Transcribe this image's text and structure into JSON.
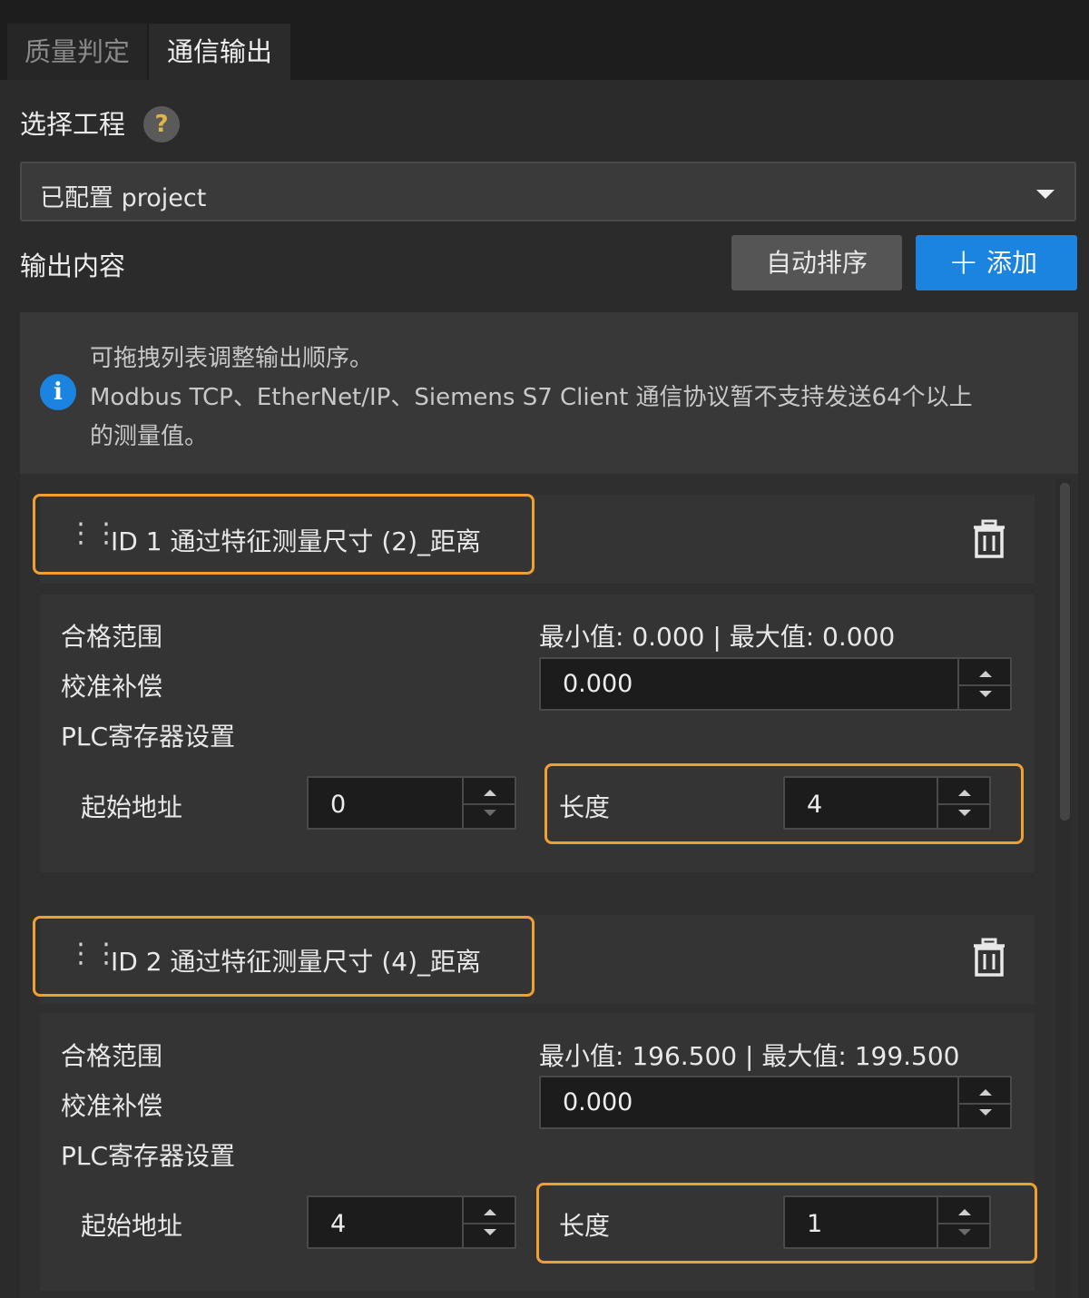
{
  "tabs": [
    {
      "label": "质量判定",
      "active": false
    },
    {
      "label": "通信输出",
      "active": true
    }
  ],
  "project_section": {
    "label": "选择工程",
    "help_icon": "?",
    "dropdown_value": "已配置 project"
  },
  "output_section": {
    "label": "输出内容",
    "sort_button": "自动排序",
    "add_button": "添加"
  },
  "info": {
    "line1": "可拖拽列表调整输出顺序。",
    "line2": "Modbus TCP、EtherNet/IP、Siemens S7 Client 通信协议暂不支持发送64个以上",
    "line3": "的测量值。"
  },
  "items": [
    {
      "title": "ID 1  通过特征测量尺寸 (2)_距离",
      "pass_range_label": "合格范围",
      "pass_range_value": "最小值: 0.000 | 最大值: 0.000",
      "calibration_label": "校准补偿",
      "calibration_value": "0.000",
      "plc_label": "PLC寄存器设置",
      "start_addr_label": "起始地址",
      "start_addr_value": "0",
      "length_label": "长度",
      "length_value": "4"
    },
    {
      "title": "ID 2  通过特征测量尺寸 (4)_距离",
      "pass_range_label": "合格范围",
      "pass_range_value": "最小值: 196.500 | 最大值: 199.500",
      "calibration_label": "校准补偿",
      "calibration_value": "0.000",
      "plc_label": "PLC寄存器设置",
      "start_addr_label": "起始地址",
      "start_addr_value": "4",
      "length_label": "长度",
      "length_value": "1"
    }
  ],
  "colors": {
    "accent_blue": "#1a84e0",
    "highlight_orange": "#f0a030"
  }
}
